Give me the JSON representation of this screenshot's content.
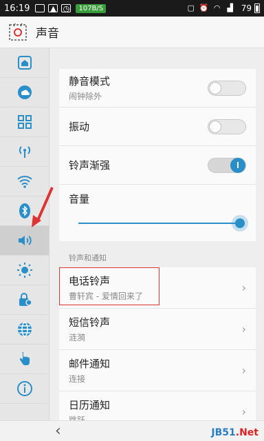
{
  "status_bar": {
    "time": "16:19",
    "speed": "107B/S",
    "battery_level": "79",
    "icons": [
      "sim-icon",
      "image-icon",
      "clock-app-icon",
      "silent-icon",
      "alarm-icon",
      "wifi-icon",
      "signal-icon",
      "battery-icon"
    ]
  },
  "header": {
    "title": "声音"
  },
  "sidebar": {
    "items": [
      {
        "name": "home-icon"
      },
      {
        "name": "cloud-icon"
      },
      {
        "name": "apps-grid-icon"
      },
      {
        "name": "hotspot-icon"
      },
      {
        "name": "wifi-icon"
      },
      {
        "name": "bluetooth-icon"
      },
      {
        "name": "speaker-icon",
        "active": true
      },
      {
        "name": "brightness-icon"
      },
      {
        "name": "lock-icon"
      },
      {
        "name": "globe-icon"
      },
      {
        "name": "hand-icon"
      },
      {
        "name": "info-icon"
      }
    ]
  },
  "settings": {
    "silent": {
      "title": "静音模式",
      "sub": "闹钟除外",
      "on": false
    },
    "vibrate": {
      "title": "振动",
      "on": false
    },
    "fade_in": {
      "title": "铃声渐强",
      "on": true
    },
    "volume": {
      "title": "音量",
      "level": 1.0
    }
  },
  "section": {
    "label": "铃声和通知"
  },
  "tones": [
    {
      "title": "电话铃声",
      "sub": "曹轩宾 - 爱情回来了"
    },
    {
      "title": "短信铃声",
      "sub": "涟漪"
    },
    {
      "title": "邮件通知",
      "sub": "连接"
    },
    {
      "title": "日历通知",
      "sub": "跳跃"
    }
  ],
  "chevron": "›",
  "nav": {
    "back": "‹"
  },
  "watermark": {
    "part1": "JB51",
    "part2": ".Net"
  },
  "colors": {
    "accent": "#2a8ec8",
    "highlight": "#dd3333"
  }
}
